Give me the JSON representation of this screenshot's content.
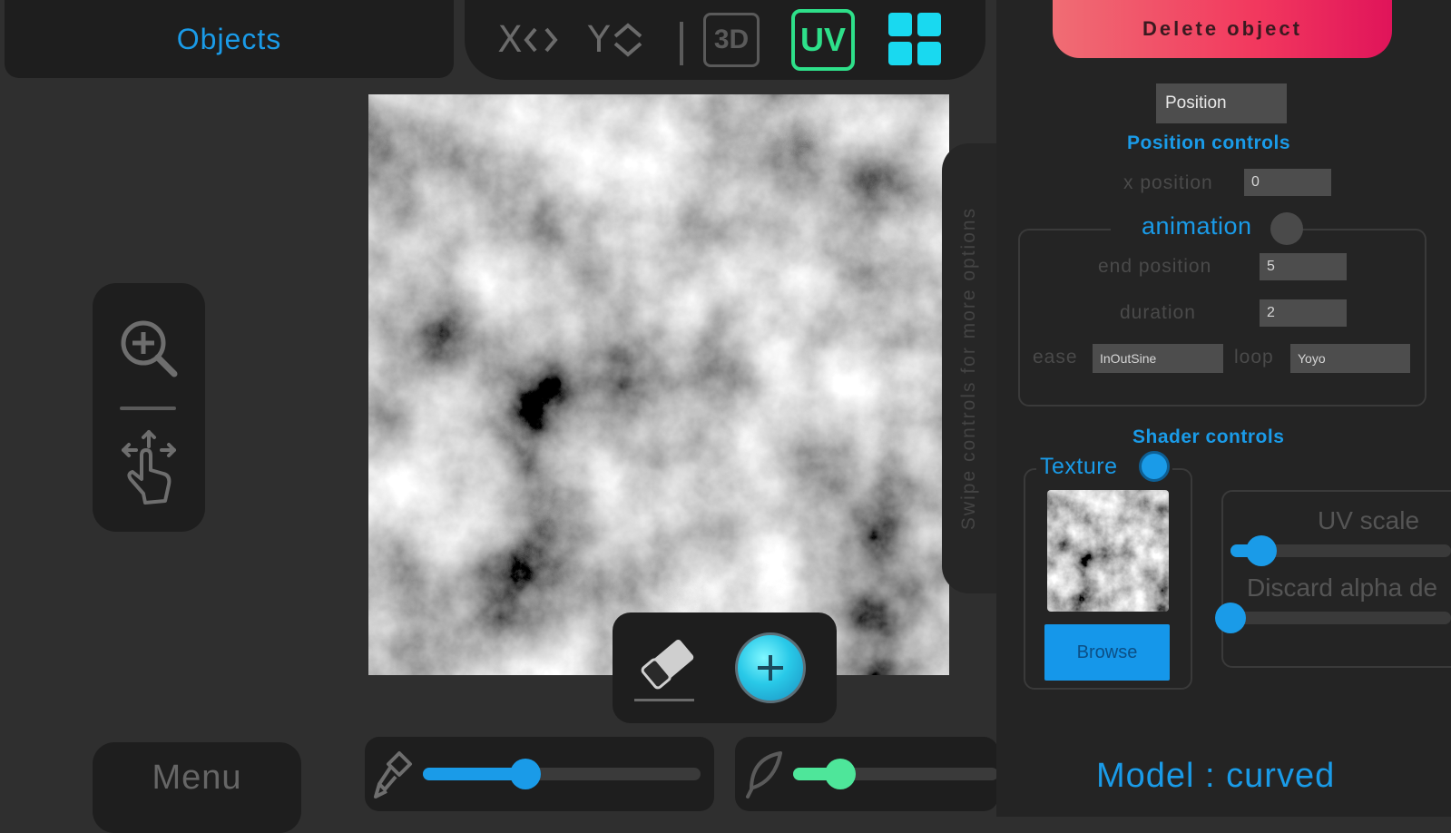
{
  "tabs": {
    "objects_label": "Objects"
  },
  "toolbar": {
    "x_axis_label": "X",
    "y_axis_label": "Y",
    "view_3d_label": "3D",
    "uv_label": "UV",
    "accent_color": "#2ee08a",
    "grid_color": "#19d9f0"
  },
  "left_tools": {
    "zoom": "zoom-in-icon",
    "pan": "pan-hand-icon"
  },
  "side_hint": {
    "text": "Swipe controls for more options"
  },
  "bottom_tools": {
    "eraser": "eraser-icon",
    "add": "plus-icon"
  },
  "menu": {
    "label": "Menu"
  },
  "brush": {
    "size_fraction": 0.37,
    "size_color": "#1a9be8",
    "softness_fraction": 0.23,
    "softness_color": "#4ee69a"
  },
  "inspector": {
    "delete_label": "Delete object",
    "section_value": "Position",
    "position_controls_title": "Position controls",
    "x_position_label": "x position",
    "x_position_value": "0",
    "animation_title": "animation",
    "end_position_label": "end position",
    "end_position_value": "5",
    "duration_label": "duration",
    "duration_value": "2",
    "ease_label": "ease",
    "ease_value": "InOutSine",
    "loop_label": "loop",
    "loop_value": "Yoyo",
    "shader_controls_title": "Shader controls",
    "texture_label": "Texture",
    "browse_label": "Browse",
    "uv_scale_label": "UV scale",
    "uv_scale_fraction": 0.14,
    "discard_alpha_label": "Discard alpha de",
    "discard_alpha_fraction": 0.0,
    "model_label": "Model : curved",
    "accent_color": "#1a9be8",
    "delete_color": "#f2385e"
  }
}
